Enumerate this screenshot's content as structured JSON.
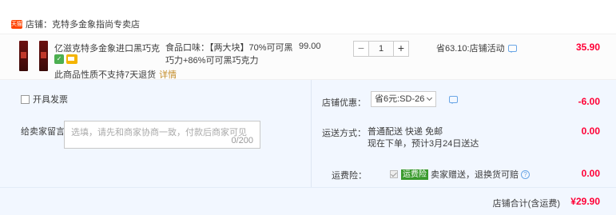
{
  "shop": {
    "logo_text": "天猫",
    "name": "店铺：克特多金象指尚专卖店"
  },
  "item": {
    "title": "亿滋克特多金象进口黑巧克力8...",
    "variant": "食品口味：【两大块】70%可可黑巧力+86%可可黑巧克力",
    "unit_price": "99.00",
    "quantity": "1",
    "promo": "省63.10:店铺活动",
    "line_total": "35.90",
    "return_note": "此商品性质不支持7天退货",
    "return_link": "详情"
  },
  "options": {
    "invoice_label": "开具发票",
    "note_label": "给卖家留言：",
    "note_placeholder": "选填，请先和商家协商一致，付款后商家可见",
    "note_counter": "0/200",
    "discount_label": "店铺优惠：",
    "discount_select": "省6元:SD-26",
    "discount_amount": "-6.00",
    "shipping_label": "运送方式：",
    "shipping_line1": "普通配送 快递 免邮",
    "shipping_line2": "现在下单，预计3月24日送达",
    "shipping_amount": "0.00",
    "insurance_label": "运费险：",
    "insurance_tag": "运费险",
    "insurance_text": "卖家赠送，退换货可赔",
    "insurance_amount": "0.00"
  },
  "total": {
    "label": "店铺合计(含运费)",
    "value": "¥29.90"
  },
  "colors": {
    "price_red": "#ff0036",
    "panel_blue": "#f2f7ff",
    "link_gold": "#c48d2a"
  }
}
